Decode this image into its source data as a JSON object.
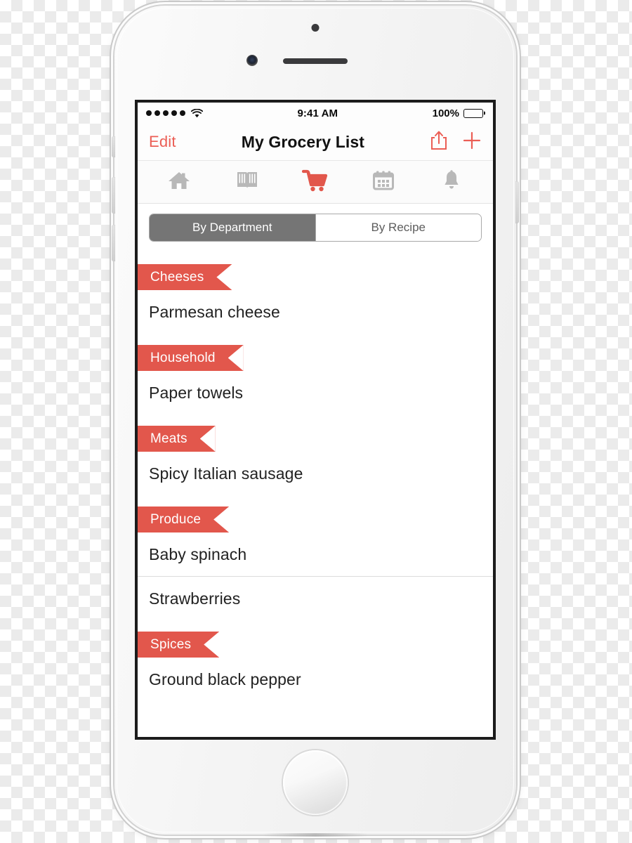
{
  "device": {
    "kind": "iphone-white",
    "home_button": "home-button"
  },
  "status_bar": {
    "signal_dots": 5,
    "wifi": "wifi-icon",
    "time": "9:41 AM",
    "battery_percent": "100%",
    "battery_level": 100
  },
  "nav_bar": {
    "edit_label": "Edit",
    "title": "My Grocery List",
    "share_icon": "share-icon",
    "add_icon": "plus-icon"
  },
  "tab_bar": {
    "active_index": 2,
    "items": [
      {
        "icon": "home-icon",
        "name": "tab-home",
        "active": false
      },
      {
        "icon": "book-icon",
        "name": "tab-recipes",
        "active": false
      },
      {
        "icon": "cart-icon",
        "name": "tab-list",
        "active": true
      },
      {
        "icon": "calendar-icon",
        "name": "tab-meal-plan",
        "active": false
      },
      {
        "icon": "bell-icon",
        "name": "tab-reminders",
        "active": false
      }
    ]
  },
  "segmented_control": {
    "selected_index": 0,
    "options": [
      {
        "label": "By Department"
      },
      {
        "label": "By Recipe"
      }
    ]
  },
  "list": {
    "sections": [
      {
        "title": "Cheeses",
        "items": [
          {
            "label": "Parmesan cheese",
            "divider": false
          }
        ]
      },
      {
        "title": "Household",
        "items": [
          {
            "label": "Paper towels",
            "divider": false
          }
        ]
      },
      {
        "title": "Meats",
        "items": [
          {
            "label": "Spicy Italian sausage",
            "divider": false
          }
        ]
      },
      {
        "title": "Produce",
        "items": [
          {
            "label": "Baby spinach",
            "divider": true
          },
          {
            "label": "Strawberries",
            "divider": false
          }
        ]
      },
      {
        "title": "Spices",
        "items": [
          {
            "label": "Ground black pepper",
            "divider": false
          }
        ]
      }
    ]
  },
  "colors": {
    "accent_red": "#e2574c",
    "edit_red": "#eb5e55",
    "segment_selected_bg": "#757575",
    "tab_inactive": "#b8b8b8",
    "text_primary": "#222222",
    "divider": "#dcdcdc"
  }
}
